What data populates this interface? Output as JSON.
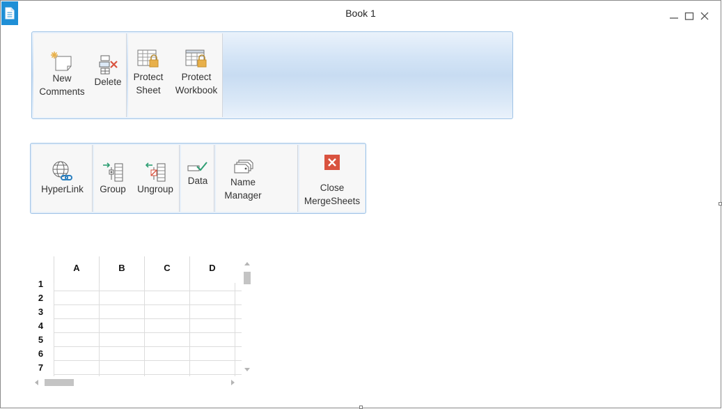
{
  "window": {
    "title": "Book 1"
  },
  "ribbon_top": {
    "buttons": [
      {
        "line1": "New",
        "line2": "Comments"
      },
      {
        "line1": "Delete"
      },
      {
        "line1": "Protect",
        "line2": "Sheet"
      },
      {
        "line1": "Protect",
        "line2": "Workbook"
      }
    ]
  },
  "ribbon_bottom": {
    "buttons": [
      {
        "line1": "HyperLink"
      },
      {
        "line1": "Group"
      },
      {
        "line1": "Ungroup"
      },
      {
        "line1": "Data"
      },
      {
        "line1": "Name",
        "line2": "Manager"
      },
      {
        "line1": "Close",
        "line2": "MergeSheets"
      }
    ]
  },
  "sheet": {
    "columns": [
      "A",
      "B",
      "C",
      "D"
    ],
    "rows": [
      "1",
      "2",
      "3",
      "4",
      "5",
      "6",
      "7"
    ]
  },
  "colors": {
    "accent": "#1f8fd6",
    "close_red": "#d9533f",
    "lock_gold": "#e8b04a"
  }
}
